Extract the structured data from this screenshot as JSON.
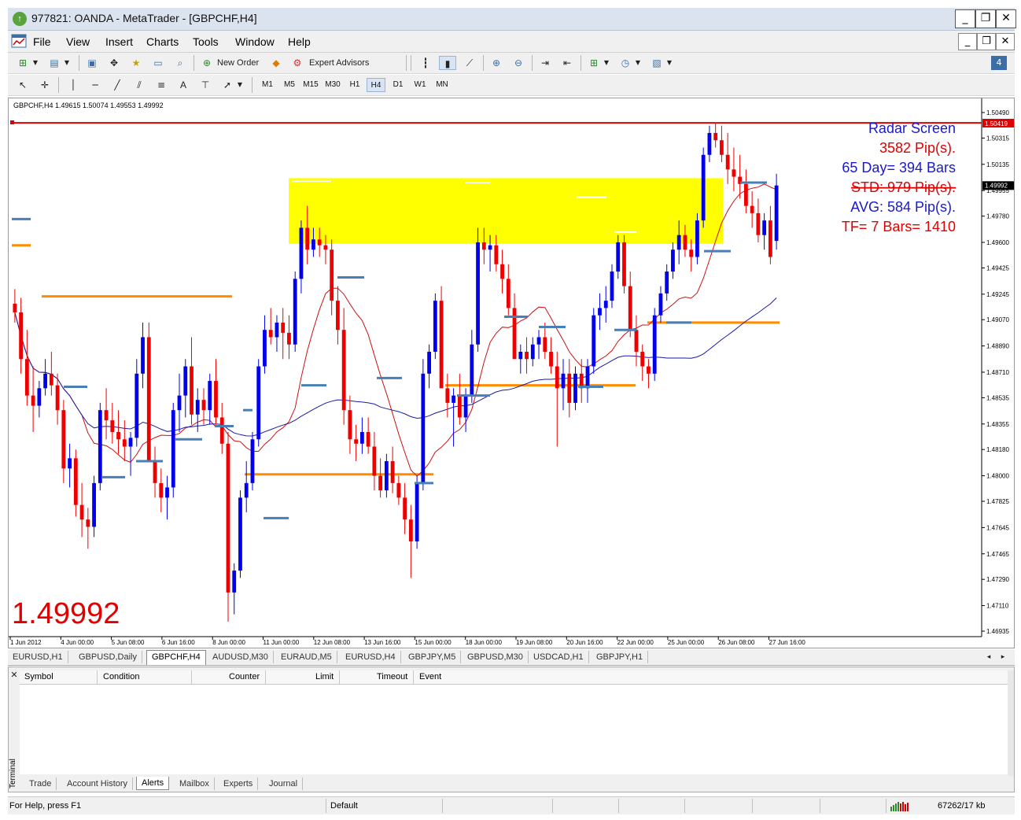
{
  "window": {
    "title": "977821: OANDA - MetaTrader - [GBPCHF,H4]",
    "app_icon": "metatrader-icon",
    "minimize_glyph": "_",
    "restore_glyph": "❐",
    "close_glyph": "✕"
  },
  "menu": {
    "items": [
      "File",
      "View",
      "Insert",
      "Charts",
      "Tools",
      "Window",
      "Help"
    ]
  },
  "toolbar1": {
    "new_order": "New Order",
    "expert_advisors": "Expert Advisors"
  },
  "toolbar2": {
    "text_tool": "A",
    "timeframes": [
      "M1",
      "M5",
      "M15",
      "M30",
      "H1",
      "H4",
      "D1",
      "W1",
      "MN"
    ],
    "active_timeframe": "H4"
  },
  "chart_header": "GBPCHF,H4  1.49615 1.50074 1.49553 1.49992",
  "price_big": "1.49992",
  "radar": {
    "title": "Radar Screen",
    "pips": "3582 Pip(s).",
    "days": "65 Day= 394 Bars",
    "std": "STD: 979 Pip(s).",
    "avg": "AVG: 584 Pip(s).",
    "tf": "TF= 7 Bars= 1410"
  },
  "price_tag_red": "1.50419",
  "price_tag_current": "1.49992",
  "colors": {
    "bull": "#0000ee",
    "bear": "#ee0000",
    "zone": "#ffff00",
    "level": "#ff8c00",
    "marker": "#4a7fb5",
    "ma_blue": "#1a1aa8",
    "ma_red": "#cc1111",
    "resistance": "#e00000"
  },
  "chart_data": {
    "type": "candlestick",
    "symbol": "GBPCHF",
    "timeframe": "H4",
    "y_ticks": [
      "1.50490",
      "1.50315",
      "1.50135",
      "1.49955",
      "1.49780",
      "1.49600",
      "1.49425",
      "1.49245",
      "1.49070",
      "1.48890",
      "1.48710",
      "1.48535",
      "1.48355",
      "1.48180",
      "1.48000",
      "1.47825",
      "1.47645",
      "1.47465",
      "1.47290",
      "1.47110",
      "1.46935"
    ],
    "ylim": [
      1.46935,
      1.5049
    ],
    "x_labels": [
      "1 Jun 2012",
      "4 Jun 00:00",
      "5 Jun 08:00",
      "6 Jun 16:00",
      "8 Jun 00:00",
      "11 Jun 00:00",
      "12 Jun 08:00",
      "13 Jun 16:00",
      "15 Jun 00:00",
      "18 Jun 00:00",
      "19 Jun 08:00",
      "20 Jun 16:00",
      "22 Jun 00:00",
      "25 Jun 00:00",
      "26 Jun 08:00",
      "27 Jun 16:00"
    ],
    "resistance_line": 1.50419,
    "current_price": 1.49992,
    "supply_zone": [
      1.4959,
      1.5004
    ],
    "candles": [
      [
        1.4918,
        1.4928,
        1.4905,
        1.4912
      ],
      [
        1.4912,
        1.4922,
        1.487,
        1.488
      ],
      [
        1.488,
        1.49,
        1.4848,
        1.4855
      ],
      [
        1.4855,
        1.4875,
        1.483,
        1.4848
      ],
      [
        1.4848,
        1.4865,
        1.484,
        1.486
      ],
      [
        1.486,
        1.488,
        1.4855,
        1.487
      ],
      [
        1.487,
        1.4885,
        1.4855,
        1.4862
      ],
      [
        1.4862,
        1.487,
        1.4835,
        1.4845
      ],
      [
        1.4845,
        1.4852,
        1.4795,
        1.4805
      ],
      [
        1.4805,
        1.4822,
        1.4792,
        1.4812
      ],
      [
        1.4812,
        1.4818,
        1.4772,
        1.478
      ],
      [
        1.478,
        1.4795,
        1.4758,
        1.477
      ],
      [
        1.477,
        1.4778,
        1.475,
        1.4765
      ],
      [
        1.4765,
        1.48,
        1.4758,
        1.4795
      ],
      [
        1.4795,
        1.485,
        1.479,
        1.4845
      ],
      [
        1.4845,
        1.486,
        1.4825,
        1.4838
      ],
      [
        1.4838,
        1.485,
        1.4822,
        1.483
      ],
      [
        1.483,
        1.4845,
        1.4815,
        1.4825
      ],
      [
        1.4825,
        1.4838,
        1.481,
        1.482
      ],
      [
        1.482,
        1.483,
        1.48,
        1.4826
      ],
      [
        1.4826,
        1.488,
        1.482,
        1.487
      ],
      [
        1.487,
        1.4905,
        1.486,
        1.4895
      ],
      [
        1.4895,
        1.4905,
        1.4818,
        1.481
      ],
      [
        1.481,
        1.482,
        1.4785,
        1.4795
      ],
      [
        1.4795,
        1.4805,
        1.4775,
        1.4785
      ],
      [
        1.4785,
        1.48,
        1.477,
        1.4792
      ],
      [
        1.4792,
        1.485,
        1.4785,
        1.4845
      ],
      [
        1.4845,
        1.487,
        1.483,
        1.4855
      ],
      [
        1.4855,
        1.488,
        1.484,
        1.4875
      ],
      [
        1.4875,
        1.4895,
        1.4835,
        1.4842
      ],
      [
        1.4842,
        1.486,
        1.483,
        1.4852
      ],
      [
        1.4852,
        1.486,
        1.4835,
        1.4845
      ],
      [
        1.4845,
        1.487,
        1.4835,
        1.4865
      ],
      [
        1.4865,
        1.488,
        1.4835,
        1.484
      ],
      [
        1.484,
        1.485,
        1.4815,
        1.4822
      ],
      [
        1.4822,
        1.483,
        1.47,
        1.472
      ],
      [
        1.472,
        1.474,
        1.4705,
        1.4735
      ],
      [
        1.4735,
        1.479,
        1.473,
        1.4785
      ],
      [
        1.4785,
        1.481,
        1.4775,
        1.4795
      ],
      [
        1.4795,
        1.483,
        1.479,
        1.4825
      ],
      [
        1.4825,
        1.488,
        1.482,
        1.4875
      ],
      [
        1.4875,
        1.491,
        1.487,
        1.49
      ],
      [
        1.49,
        1.4915,
        1.489,
        1.4895
      ],
      [
        1.4895,
        1.491,
        1.4885,
        1.4905
      ],
      [
        1.4905,
        1.4915,
        1.488,
        1.4898
      ],
      [
        1.4898,
        1.491,
        1.488,
        1.489
      ],
      [
        1.489,
        1.494,
        1.4885,
        1.4935
      ],
      [
        1.4935,
        1.4975,
        1.4925,
        1.497
      ],
      [
        1.497,
        1.4985,
        1.4945,
        1.4955
      ],
      [
        1.4955,
        1.497,
        1.495,
        1.4962
      ],
      [
        1.4962,
        1.497,
        1.495,
        1.4958
      ],
      [
        1.4958,
        1.4965,
        1.4945,
        1.4955
      ],
      [
        1.4955,
        1.4962,
        1.491,
        1.492
      ],
      [
        1.492,
        1.493,
        1.489,
        1.49
      ],
      [
        1.49,
        1.4915,
        1.4835,
        1.4845
      ],
      [
        1.4845,
        1.4855,
        1.4815,
        1.4825
      ],
      [
        1.4825,
        1.4835,
        1.481,
        1.4822
      ],
      [
        1.4822,
        1.484,
        1.4815,
        1.483
      ],
      [
        1.483,
        1.484,
        1.4815,
        1.482
      ],
      [
        1.482,
        1.483,
        1.479,
        1.48
      ],
      [
        1.48,
        1.4812,
        1.4785,
        1.479
      ],
      [
        1.479,
        1.4815,
        1.4785,
        1.481
      ],
      [
        1.481,
        1.482,
        1.4788,
        1.4795
      ],
      [
        1.4795,
        1.48,
        1.478,
        1.4785
      ],
      [
        1.4785,
        1.4795,
        1.476,
        1.477
      ],
      [
        1.477,
        1.478,
        1.473,
        1.4755
      ],
      [
        1.4755,
        1.48,
        1.475,
        1.4795
      ],
      [
        1.4795,
        1.488,
        1.479,
        1.487
      ],
      [
        1.487,
        1.489,
        1.486,
        1.4885
      ],
      [
        1.4885,
        1.4925,
        1.488,
        1.492
      ],
      [
        1.492,
        1.493,
        1.487,
        1.486
      ],
      [
        1.486,
        1.487,
        1.484,
        1.485
      ],
      [
        1.485,
        1.486,
        1.482,
        1.4855
      ],
      [
        1.4855,
        1.487,
        1.4835,
        1.484
      ],
      [
        1.484,
        1.486,
        1.483,
        1.4855
      ],
      [
        1.4855,
        1.49,
        1.485,
        1.489
      ],
      [
        1.489,
        1.497,
        1.4885,
        1.496
      ],
      [
        1.496,
        1.497,
        1.4945,
        1.4955
      ],
      [
        1.4955,
        1.4965,
        1.494,
        1.4958
      ],
      [
        1.4958,
        1.4965,
        1.494,
        1.4945
      ],
      [
        1.4945,
        1.4955,
        1.4925,
        1.4935
      ],
      [
        1.4935,
        1.4945,
        1.491,
        1.4915
      ],
      [
        1.4915,
        1.4925,
        1.4885,
        1.488
      ],
      [
        1.488,
        1.489,
        1.487,
        1.4885
      ],
      [
        1.4885,
        1.4895,
        1.487,
        1.488
      ],
      [
        1.488,
        1.4895,
        1.4875,
        1.489
      ],
      [
        1.489,
        1.49,
        1.488,
        1.4895
      ],
      [
        1.4895,
        1.4905,
        1.488,
        1.4885
      ],
      [
        1.4885,
        1.4895,
        1.487,
        1.4875
      ],
      [
        1.4875,
        1.4885,
        1.482,
        1.486
      ],
      [
        1.486,
        1.488,
        1.4845,
        1.487
      ],
      [
        1.487,
        1.488,
        1.484,
        1.485
      ],
      [
        1.485,
        1.4875,
        1.4845,
        1.487
      ],
      [
        1.487,
        1.488,
        1.485,
        1.486
      ],
      [
        1.486,
        1.488,
        1.485,
        1.4875
      ],
      [
        1.4875,
        1.4915,
        1.487,
        1.491
      ],
      [
        1.491,
        1.4925,
        1.49,
        1.4915
      ],
      [
        1.4915,
        1.493,
        1.4905,
        1.492
      ],
      [
        1.492,
        1.4945,
        1.4915,
        1.494
      ],
      [
        1.494,
        1.4965,
        1.4935,
        1.496
      ],
      [
        1.496,
        1.4965,
        1.4925,
        1.493
      ],
      [
        1.493,
        1.494,
        1.4895,
        1.49
      ],
      [
        1.49,
        1.491,
        1.4875,
        1.4885
      ],
      [
        1.4885,
        1.489,
        1.4865,
        1.4875
      ],
      [
        1.4875,
        1.488,
        1.486,
        1.487
      ],
      [
        1.487,
        1.4915,
        1.4865,
        1.491
      ],
      [
        1.491,
        1.493,
        1.4905,
        1.4925
      ],
      [
        1.4925,
        1.4945,
        1.492,
        1.494
      ],
      [
        1.494,
        1.496,
        1.4935,
        1.4955
      ],
      [
        1.4955,
        1.4975,
        1.4945,
        1.4965
      ],
      [
        1.4965,
        1.4972,
        1.495,
        1.4955
      ],
      [
        1.4955,
        1.4962,
        1.494,
        1.495
      ],
      [
        1.495,
        1.498,
        1.4945,
        1.4975
      ],
      [
        1.4975,
        1.5025,
        1.497,
        1.502
      ],
      [
        1.502,
        1.504,
        1.5015,
        1.5035
      ],
      [
        1.5035,
        1.5042,
        1.5025,
        1.503
      ],
      [
        1.503,
        1.504,
        1.5015,
        1.502
      ],
      [
        1.502,
        1.5035,
        1.5,
        1.501
      ],
      [
        1.501,
        1.5025,
        1.4995,
        1.5005
      ],
      [
        1.5005,
        1.502,
        1.499,
        1.5
      ],
      [
        1.5,
        1.501,
        1.498,
        1.4985
      ],
      [
        1.4985,
        1.4995,
        1.497,
        1.498
      ],
      [
        1.498,
        1.499,
        1.496,
        1.4965
      ],
      [
        1.4965,
        1.498,
        1.4955,
        1.4975
      ],
      [
        1.4975,
        1.4985,
        1.4945,
        1.495
      ],
      [
        1.4961,
        1.5007,
        1.4955,
        1.4999
      ]
    ]
  },
  "chart_tabs": [
    "EURUSD,H1",
    "GBPUSD,Daily",
    "GBPCHF,H4",
    "AUDUSD,M30",
    "EURAUD,M5",
    "EURUSD,H4",
    "GBPJPY,M5",
    "GBPUSD,M30",
    "USDCAD,H1",
    "GBPJPY,H1"
  ],
  "active_chart_tab": "GBPCHF,H4",
  "terminal": {
    "label": "Terminal",
    "columns": [
      "Symbol",
      "Condition",
      "Counter",
      "Limit",
      "Timeout",
      "Event"
    ],
    "tabs": [
      "Trade",
      "Account History",
      "Alerts",
      "Mailbox",
      "Experts",
      "Journal"
    ],
    "active_tab": "Alerts"
  },
  "status": {
    "help": "For Help, press F1",
    "profile": "Default",
    "memory": "67262/17 kb"
  }
}
